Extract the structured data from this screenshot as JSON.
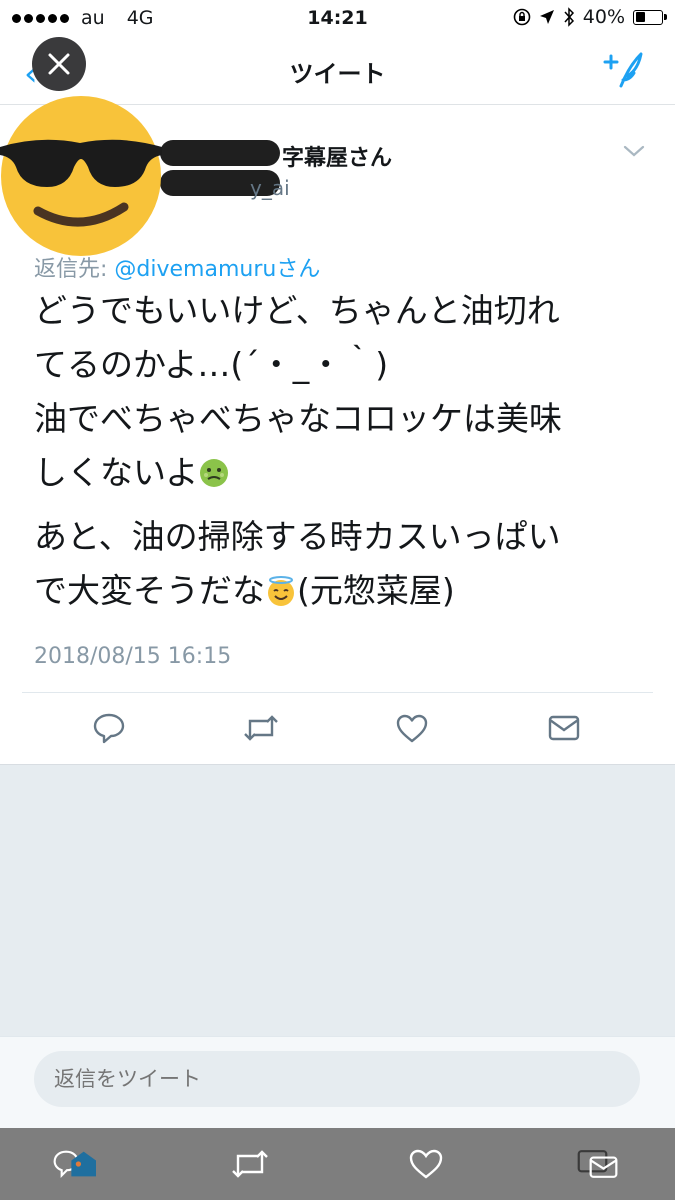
{
  "status_bar": {
    "carrier": "au",
    "network": "4G",
    "time": "14:21",
    "battery": "40%",
    "battery_level": 0.4
  },
  "nav": {
    "title": "ツイート",
    "icons": [
      "close-icon",
      "back-chevron-icon",
      "compose-tweet-icon"
    ]
  },
  "tweet": {
    "display_name_suffix": "字幕屋さん",
    "handle_visible": "y_ai",
    "reply_to_prefix": "返信先: ",
    "reply_to_mention": "@divemamuruさん",
    "body_lines": [
      "どうでもいいけど、ちゃんと油切れ",
      "てるのかよ…(´・_・｀)",
      "油でべちゃべちゃなコロッケは美味",
      "しくないよ"
    ],
    "body_lines_2": [
      "あと、油の掃除する時カスいっぱい",
      "で大変そうだな"
    ],
    "body_line_2_tail": "(元惣菜屋)",
    "emoji_1": "nauseated-face-emoji",
    "emoji_2": "smiling-face-with-halo-emoji",
    "timestamp": "2018/08/15 16:15",
    "avatar": "sunglasses-smiley-overlay"
  },
  "actions": [
    "reply-icon",
    "retweet-icon",
    "like-icon",
    "direct-message-icon"
  ],
  "reply_bar": {
    "placeholder": "返信をツイート"
  },
  "colors": {
    "accent": "#1da1f2",
    "muted": "#8899a6",
    "background_gray": "#e6ecf0",
    "bottom_bar": "#7e7e7e"
  }
}
